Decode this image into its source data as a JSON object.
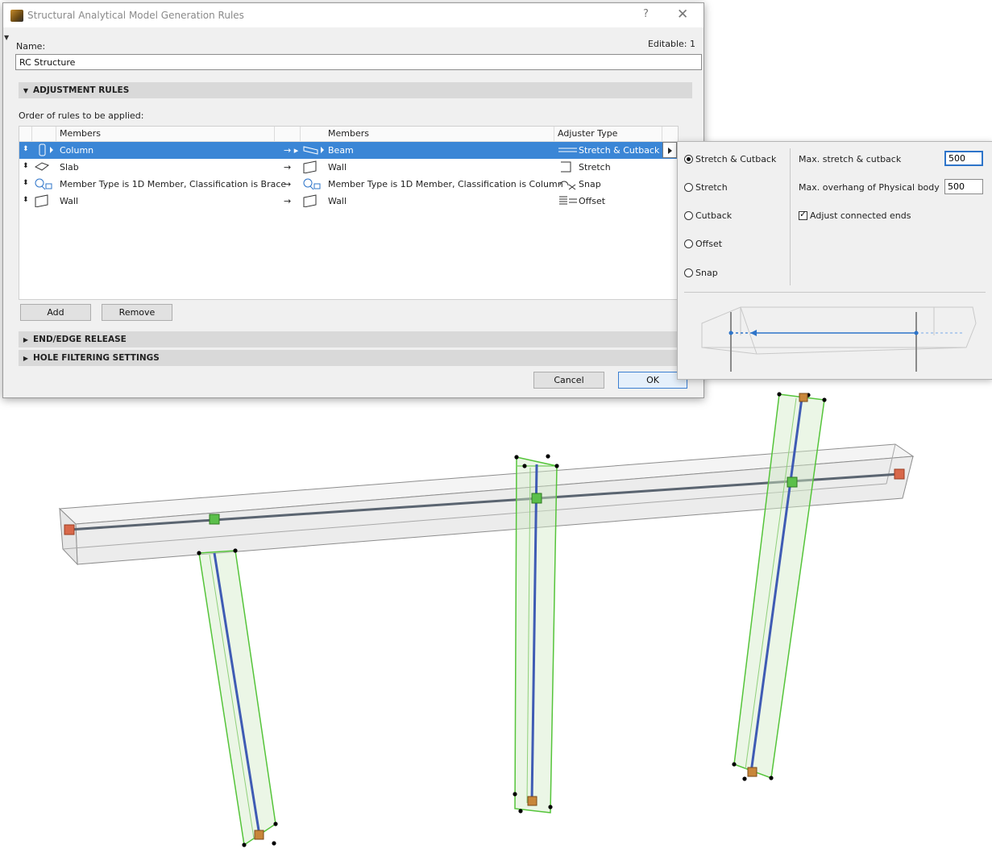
{
  "dialog": {
    "title": "Structural Analytical Model Generation Rules",
    "help_glyph": "?",
    "close_glyph": "✕",
    "name_label": "Name:",
    "editable_label": "Editable: 1",
    "name_value": "RC Structure"
  },
  "adjustment": {
    "header": "ADJUSTMENT RULES",
    "order_label": "Order of rules to be applied:",
    "columns": {
      "members_left": "Members",
      "members_right": "Members",
      "adjuster": "Adjuster Type"
    },
    "rows": [
      {
        "member": "Column",
        "target": "Beam",
        "adjuster": "Stretch & Cutback",
        "selected": true
      },
      {
        "member": "Slab",
        "target": "Wall",
        "adjuster": "Stretch",
        "selected": false
      },
      {
        "member": "Member Type is 1D Member, Classification is Brace",
        "target": "Member Type is 1D Member, Classification  is Column",
        "adjuster": "Snap",
        "selected": false
      },
      {
        "member": "Wall",
        "target": "Wall",
        "adjuster": "Offset",
        "selected": false
      }
    ],
    "add_label": "Add",
    "remove_label": "Remove"
  },
  "sections": {
    "end_edge": "END/EDGE RELEASE",
    "hole": "HOLE FILTERING SETTINGS"
  },
  "footer": {
    "cancel_label": "Cancel",
    "ok_label": "OK"
  },
  "adjuster_popover": {
    "options": [
      {
        "label": "Stretch & Cutback",
        "selected": true
      },
      {
        "label": "Stretch",
        "selected": false
      },
      {
        "label": "Cutback",
        "selected": false
      },
      {
        "label": "Offset",
        "selected": false
      },
      {
        "label": "Snap",
        "selected": false
      }
    ],
    "max_stretch_label": "Max. stretch & cutback",
    "max_stretch_value": "500",
    "max_overhang_label": "Max. overhang of Physical body",
    "max_overhang_value": "500",
    "adjust_ends_label": "Adjust connected ends",
    "adjust_ends_checked": true
  },
  "colors": {
    "selection": "#3b86d6",
    "element_outline": "#55c43a",
    "axis_line": "#3f5bb4",
    "beam_axis": "#5a6470",
    "end_node": "#d8684a"
  }
}
